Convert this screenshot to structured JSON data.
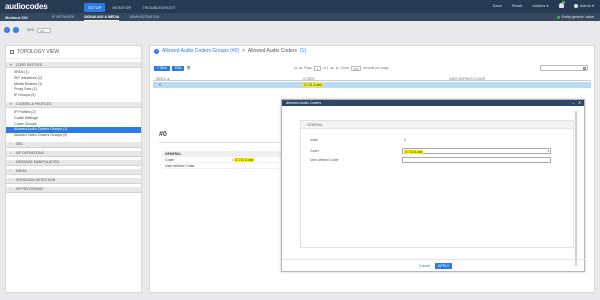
{
  "header": {
    "logo": "audiocodes",
    "nav": [
      "SETUP",
      "MONITOR",
      "TROUBLESHOOT"
    ],
    "actions": [
      "Save",
      "Reset",
      "Actions ▾"
    ],
    "user": "Admin ▾"
  },
  "subheader": {
    "device": "Mediant SW",
    "tabs": [
      "IP NETWORK",
      "SIGNALING & MEDIA",
      "ADMINISTRATION"
    ],
    "status": "Entity generic: value"
  },
  "navrow": {
    "srd_label": "SRD",
    "srd_value": "All"
  },
  "left_panel": {
    "title": "TOPOLOGY VIEW",
    "sections": [
      {
        "label": "CORE ENTITIES",
        "expanded": true,
        "items": [
          "SRDs (1)",
          "SIP Interfaces (2)",
          "Media Realms (1)",
          "Proxy Sets (1)",
          "IP Groups (2)"
        ]
      },
      {
        "label": "CODERS & PROFILES",
        "expanded": true,
        "items": [
          "IP Profiles (2)",
          "Coder Settings",
          "Coder Groups",
          "Allowed Audio Coders Groups (1)",
          "Allowed Video Coders Groups (0)"
        ]
      },
      {
        "label": "SBC",
        "expanded": false,
        "items": []
      },
      {
        "label": "SIP DEFINITIONS",
        "expanded": false,
        "items": []
      },
      {
        "label": "MESSAGE MANIPULATION",
        "expanded": false,
        "items": []
      },
      {
        "label": "MEDIA",
        "expanded": false,
        "items": []
      },
      {
        "label": "INTRUSION DETECTION",
        "expanded": false,
        "items": []
      },
      {
        "label": "SIP RECORDING",
        "expanded": false,
        "items": []
      }
    ],
    "selected_item": "Allowed Audio Coders Groups (1)"
  },
  "right_panel": {
    "breadcrumb_link": "Allowed Audio Coders Groups (#0)",
    "breadcrumb_sep": ">",
    "breadcrumb_current": "Allowed Audio Coders",
    "breadcrumb_count": "(1)",
    "toolbar": {
      "new": "+ New",
      "edit": "Edit",
      "delete_icon": "trash-icon"
    },
    "pager": {
      "page_label": "Page",
      "page": "1",
      "of": "of 1",
      "show_label": "Show",
      "show_value": "10 ▾",
      "per_page": "records per page"
    },
    "table": {
      "headers": [
        "INDEX ▲",
        "CODER",
        "USER-DEFINED CODER"
      ],
      "rows": [
        [
          "0",
          "G.711 A-law",
          ""
        ]
      ]
    },
    "detail": {
      "id": "#0",
      "section": "GENERAL",
      "fields": [
        {
          "label": "Coder",
          "value": "G.711 A-law"
        },
        {
          "label": "User-defined Coder",
          "value": ""
        }
      ]
    }
  },
  "dialog": {
    "title": "Allowed Audio Coders",
    "section": "GENERAL",
    "fields": {
      "index_label": "Index",
      "index_value": "0",
      "coder_label": "Coder",
      "coder_value": "G.711 A-law",
      "user_coder_label": "User-defined Coder",
      "user_coder_value": ""
    },
    "cancel": "Cancel",
    "apply": "APPLY"
  },
  "colors": {
    "accent": "#2c7be5",
    "topbar": "#263a52",
    "highlight": "#fff200",
    "selected_row": "#b7dcf3"
  }
}
